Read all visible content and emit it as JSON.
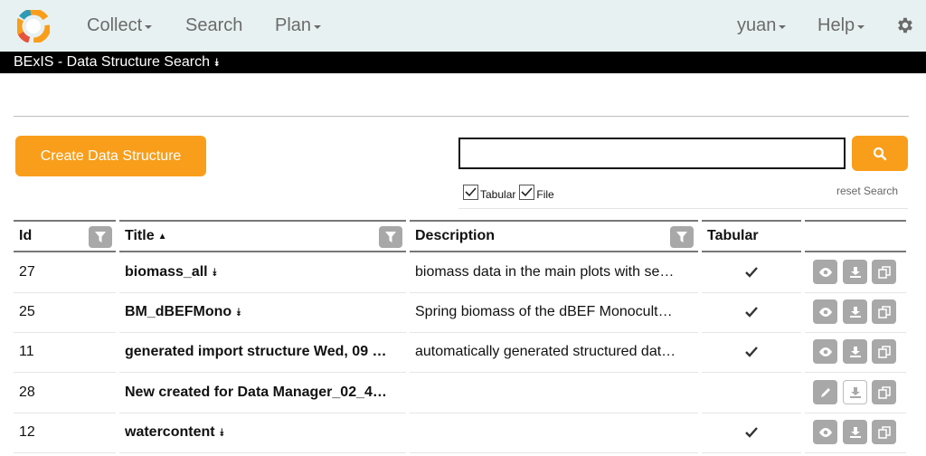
{
  "nav": {
    "collect": "Collect",
    "search": "Search",
    "plan": "Plan",
    "user": "yuan",
    "help": "Help"
  },
  "titlebar": {
    "title": "BExIS - Data Structure Search"
  },
  "toolbar": {
    "create_label": "Create Data Structure"
  },
  "search": {
    "value": "",
    "placeholder": ""
  },
  "filters": {
    "tabular": "Tabular",
    "file": "File",
    "reset": "reset Search"
  },
  "table": {
    "headers": {
      "id": "Id",
      "title": "Title",
      "description": "Description",
      "tabular": "Tabular"
    },
    "rows": [
      {
        "id": "27",
        "title": "biomass_all",
        "desc": "biomass data in the main plots with se…",
        "tabular": true,
        "actions": [
          "view",
          "download",
          "copy"
        ]
      },
      {
        "id": "25",
        "title": "BM_dBEFMono",
        "desc": "Spring biomass of the dBEF Monocult…",
        "tabular": true,
        "actions": [
          "view",
          "download",
          "copy"
        ]
      },
      {
        "id": "11",
        "title": "generated import structure Wed, 09 …",
        "desc": "automatically generated structured dat…",
        "tabular": true,
        "actions": [
          "view",
          "download",
          "copy"
        ]
      },
      {
        "id": "28",
        "title": "New created for Data Manager_02_4…",
        "desc": "",
        "tabular": false,
        "actions": [
          "edit",
          "download",
          "copy"
        ]
      },
      {
        "id": "12",
        "title": "watercontent",
        "desc": "",
        "tabular": true,
        "actions": [
          "view",
          "download",
          "copy"
        ]
      }
    ]
  }
}
